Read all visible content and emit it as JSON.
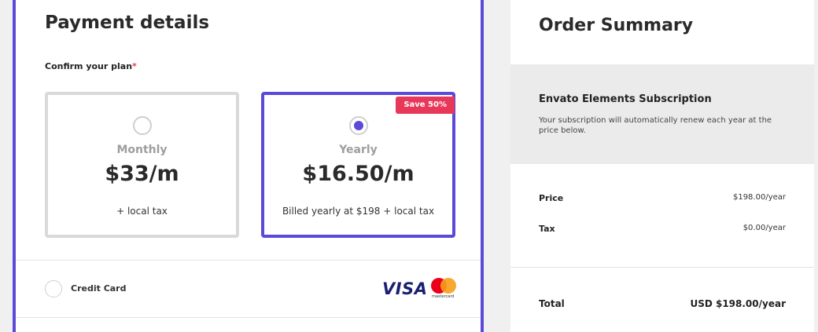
{
  "payment": {
    "title": "Payment details",
    "confirm_label": "Confirm your plan",
    "required_mark": "*",
    "plans": [
      {
        "name": "Monthly",
        "price": "$33/m",
        "note": "+ local tax",
        "selected": false
      },
      {
        "name": "Yearly",
        "price": "$16.50/m",
        "note": "Billed yearly at $198 + local tax",
        "selected": true,
        "badge": "Save 50%"
      }
    ],
    "method": {
      "label": "Credit Card",
      "logos": [
        "visa-logo",
        "mastercard-logo"
      ],
      "visa_text": "VISA",
      "mastercard_text": "mastercard"
    }
  },
  "summary": {
    "title": "Order Summary",
    "product": "Envato Elements Subscription",
    "description": "Your subscription will automatically renew each year at the price below.",
    "rows": [
      {
        "label": "Price",
        "value": "$198.00/year"
      },
      {
        "label": "Tax",
        "value": "$0.00/year"
      }
    ],
    "total_label": "Total",
    "total_value": "USD $198.00/year"
  },
  "colors": {
    "accent": "#5b4ad8",
    "badge": "#e8385a",
    "summary_band": "#ebebeb"
  }
}
